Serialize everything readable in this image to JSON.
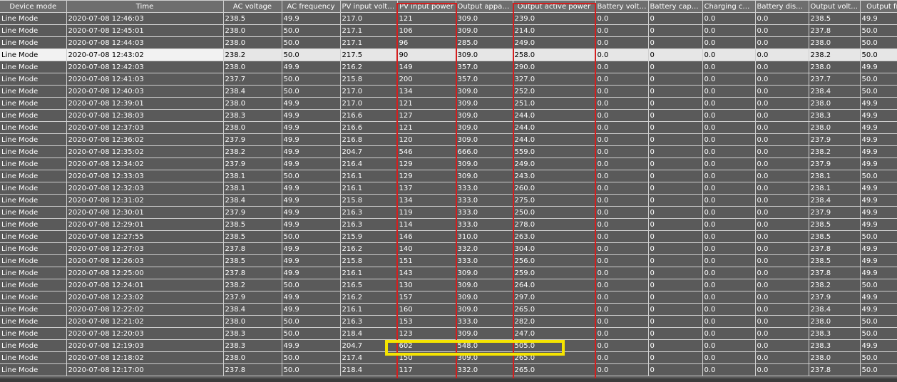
{
  "table": {
    "columns": [
      "Device mode",
      "Time",
      "AC voltage",
      "AC frequency",
      "PV input voltage",
      "PV input power",
      "Output apparen...",
      "Output active power",
      "Battery voltage",
      "Battery capacity",
      "Charging curr...",
      "Battery discha...",
      "Output voltage",
      "Output freq"
    ],
    "rows": [
      [
        "Line Mode",
        "2020-07-08 12:46:03",
        "238.5",
        "49.9",
        "217.0",
        "121",
        "309.0",
        "239.0",
        "0.0",
        "0",
        "0.0",
        "0.0",
        "238.5",
        "49.9"
      ],
      [
        "Line Mode",
        "2020-07-08 12:45:01",
        "238.0",
        "50.0",
        "217.1",
        "106",
        "309.0",
        "214.0",
        "0.0",
        "0",
        "0.0",
        "0.0",
        "237.8",
        "50.0"
      ],
      [
        "Line Mode",
        "2020-07-08 12:44:03",
        "238.0",
        "50.0",
        "217.1",
        "96",
        "285.0",
        "249.0",
        "0.0",
        "0",
        "0.0",
        "0.0",
        "238.0",
        "50.0"
      ],
      [
        "Line Mode",
        "2020-07-08 12:43:02",
        "238.2",
        "50.0",
        "217.5",
        "90",
        "309.0",
        "258.0",
        "0.0",
        "0",
        "0.0",
        "0.0",
        "238.2",
        "50.0"
      ],
      [
        "Line Mode",
        "2020-07-08 12:42:03",
        "238.0",
        "49.9",
        "216.2",
        "149",
        "357.0",
        "290.0",
        "0.0",
        "0",
        "0.0",
        "0.0",
        "238.0",
        "49.9"
      ],
      [
        "Line Mode",
        "2020-07-08 12:41:03",
        "237.7",
        "50.0",
        "215.8",
        "200",
        "357.0",
        "327.0",
        "0.0",
        "0",
        "0.0",
        "0.0",
        "237.7",
        "50.0"
      ],
      [
        "Line Mode",
        "2020-07-08 12:40:03",
        "238.4",
        "50.0",
        "217.0",
        "134",
        "309.0",
        "252.0",
        "0.0",
        "0",
        "0.0",
        "0.0",
        "238.4",
        "50.0"
      ],
      [
        "Line Mode",
        "2020-07-08 12:39:01",
        "238.0",
        "49.9",
        "217.0",
        "121",
        "309.0",
        "251.0",
        "0.0",
        "0",
        "0.0",
        "0.0",
        "238.0",
        "49.9"
      ],
      [
        "Line Mode",
        "2020-07-08 12:38:03",
        "238.3",
        "49.9",
        "216.6",
        "127",
        "309.0",
        "244.0",
        "0.0",
        "0",
        "0.0",
        "0.0",
        "238.3",
        "49.9"
      ],
      [
        "Line Mode",
        "2020-07-08 12:37:03",
        "238.0",
        "49.9",
        "216.6",
        "121",
        "309.0",
        "244.0",
        "0.0",
        "0",
        "0.0",
        "0.0",
        "238.0",
        "49.9"
      ],
      [
        "Line Mode",
        "2020-07-08 12:36:02",
        "237.9",
        "49.9",
        "216.8",
        "120",
        "309.0",
        "244.0",
        "0.0",
        "0",
        "0.0",
        "0.0",
        "237.9",
        "49.9"
      ],
      [
        "Line Mode",
        "2020-07-08 12:35:02",
        "238.2",
        "49.9",
        "204.7",
        "546",
        "666.0",
        "559.0",
        "0.0",
        "0",
        "0.0",
        "0.0",
        "238.2",
        "49.9"
      ],
      [
        "Line Mode",
        "2020-07-08 12:34:02",
        "237.9",
        "49.9",
        "216.4",
        "129",
        "309.0",
        "249.0",
        "0.0",
        "0",
        "0.0",
        "0.0",
        "237.9",
        "49.9"
      ],
      [
        "Line Mode",
        "2020-07-08 12:33:03",
        "238.1",
        "50.0",
        "216.1",
        "129",
        "309.0",
        "243.0",
        "0.0",
        "0",
        "0.0",
        "0.0",
        "238.1",
        "50.0"
      ],
      [
        "Line Mode",
        "2020-07-08 12:32:03",
        "238.1",
        "49.9",
        "216.1",
        "137",
        "333.0",
        "260.0",
        "0.0",
        "0",
        "0.0",
        "0.0",
        "238.1",
        "49.9"
      ],
      [
        "Line Mode",
        "2020-07-08 12:31:02",
        "238.4",
        "49.9",
        "215.8",
        "134",
        "333.0",
        "275.0",
        "0.0",
        "0",
        "0.0",
        "0.0",
        "238.4",
        "49.9"
      ],
      [
        "Line Mode",
        "2020-07-08 12:30:01",
        "237.9",
        "49.9",
        "216.3",
        "119",
        "333.0",
        "250.0",
        "0.0",
        "0",
        "0.0",
        "0.0",
        "237.9",
        "49.9"
      ],
      [
        "Line Mode",
        "2020-07-08 12:29:01",
        "238.5",
        "49.9",
        "216.3",
        "114",
        "333.0",
        "278.0",
        "0.0",
        "0",
        "0.0",
        "0.0",
        "238.5",
        "49.9"
      ],
      [
        "Line Mode",
        "2020-07-08 12:27:55",
        "238.5",
        "50.0",
        "215.9",
        "146",
        "310.0",
        "263.0",
        "0.0",
        "0",
        "0.0",
        "0.0",
        "238.5",
        "50.0"
      ],
      [
        "Line Mode",
        "2020-07-08 12:27:03",
        "237.8",
        "49.9",
        "216.2",
        "140",
        "332.0",
        "304.0",
        "0.0",
        "0",
        "0.0",
        "0.0",
        "237.8",
        "49.9"
      ],
      [
        "Line Mode",
        "2020-07-08 12:26:03",
        "238.5",
        "49.9",
        "215.8",
        "151",
        "333.0",
        "256.0",
        "0.0",
        "0",
        "0.0",
        "0.0",
        "238.5",
        "49.9"
      ],
      [
        "Line Mode",
        "2020-07-08 12:25:00",
        "237.8",
        "49.9",
        "216.1",
        "143",
        "309.0",
        "259.0",
        "0.0",
        "0",
        "0.0",
        "0.0",
        "237.8",
        "49.9"
      ],
      [
        "Line Mode",
        "2020-07-08 12:24:01",
        "238.2",
        "50.0",
        "216.5",
        "130",
        "309.0",
        "264.0",
        "0.0",
        "0",
        "0.0",
        "0.0",
        "238.2",
        "50.0"
      ],
      [
        "Line Mode",
        "2020-07-08 12:23:02",
        "237.9",
        "49.9",
        "216.2",
        "157",
        "309.0",
        "297.0",
        "0.0",
        "0",
        "0.0",
        "0.0",
        "237.9",
        "49.9"
      ],
      [
        "Line Mode",
        "2020-07-08 12:22:02",
        "238.4",
        "49.9",
        "216.1",
        "160",
        "309.0",
        "265.0",
        "0.0",
        "0",
        "0.0",
        "0.0",
        "238.4",
        "49.9"
      ],
      [
        "Line Mode",
        "2020-07-08 12:21:02",
        "238.0",
        "50.0",
        "216.3",
        "153",
        "333.0",
        "282.0",
        "0.0",
        "0",
        "0.0",
        "0.0",
        "238.0",
        "50.0"
      ],
      [
        "Line Mode",
        "2020-07-08 12:20:03",
        "238.3",
        "50.0",
        "218.4",
        "123",
        "309.0",
        "247.0",
        "0.0",
        "0",
        "0.0",
        "0.0",
        "238.3",
        "50.0"
      ],
      [
        "Line Mode",
        "2020-07-08 12:19:03",
        "238.3",
        "49.9",
        "204.7",
        "602",
        "548.0",
        "505.0",
        "0.0",
        "0",
        "0.0",
        "0.0",
        "238.3",
        "49.9"
      ],
      [
        "Line Mode",
        "2020-07-08 12:18:02",
        "238.0",
        "50.0",
        "217.4",
        "150",
        "309.0",
        "265.0",
        "0.0",
        "0",
        "0.0",
        "0.0",
        "238.0",
        "50.0"
      ],
      [
        "Line Mode",
        "2020-07-08 12:17:00",
        "237.8",
        "50.0",
        "218.4",
        "117",
        "332.0",
        "265.0",
        "0.0",
        "0",
        "0.0",
        "0.0",
        "237.8",
        "50.0"
      ]
    ],
    "selected_row": 3
  },
  "annotations": {
    "red_outline_color": "#d41f1f",
    "yellow_outline_color": "#f5e400",
    "red_outlined_columns": [
      "PV input power",
      "Output active power"
    ],
    "yellow_outlined_row": 27
  }
}
